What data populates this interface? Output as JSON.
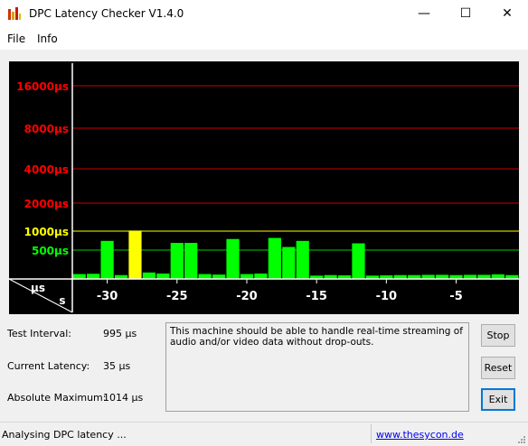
{
  "window": {
    "title": "DPC Latency Checker V1.4.0",
    "minimize_glyph": "—",
    "maximize_glyph": "☐",
    "close_glyph": "✕"
  },
  "menu": {
    "items": [
      "File",
      "Info"
    ]
  },
  "chart_data": {
    "type": "bar",
    "xlabel": "s",
    "ylabel": "µs",
    "x_ticks": [
      -30,
      -25,
      -20,
      -15,
      -10,
      -5
    ],
    "x_tick_labels": [
      "-30",
      "-25",
      "-20",
      "-15",
      "-10",
      "-5"
    ],
    "y_tick_labels": [
      "16000µs",
      "8000µs",
      "4000µs",
      "2000µs",
      "1000µs",
      "500µs"
    ],
    "y_tick_colors": [
      "#ff0000",
      "#ff0000",
      "#ff0000",
      "#ff0000",
      "#ffff00",
      "#00ff00"
    ],
    "x_range": [
      -32.5,
      -0.5
    ],
    "bar_times": [
      -32,
      -31,
      -30,
      -29,
      -28,
      -27,
      -26,
      -25,
      -24,
      -23,
      -22,
      -21,
      -20,
      -19,
      -18,
      -17,
      -16,
      -15,
      -14,
      -13,
      -12,
      -11,
      -10,
      -9,
      -8,
      -7,
      -6,
      -5,
      -4,
      -3,
      -2,
      -1
    ],
    "values_us": [
      60,
      65,
      700,
      40,
      1014,
      90,
      70,
      650,
      650,
      60,
      50,
      750,
      60,
      70,
      780,
      560,
      700,
      30,
      40,
      35,
      640,
      30,
      35,
      40,
      40,
      45,
      45,
      40,
      45,
      45,
      55,
      40
    ],
    "colors": {
      "background": "#000000",
      "normal_bar": "#00ff00",
      "warning_bar": "#ffff00",
      "grid_red": "#cc0000",
      "grid_yellow": "#ffff00",
      "grid_green": "#00cc00",
      "axis": "#ffffff"
    }
  },
  "info": {
    "test_interval_label": "Test Interval:",
    "test_interval_value": "995 µs",
    "current_latency_label": "Current Latency:",
    "current_latency_value": "35 µs",
    "absolute_maximum_label": "Absolute Maximum:",
    "absolute_maximum_value": "1014 µs"
  },
  "message": "This machine should be able to handle real-time streaming of audio and/or video data without drop-outs.",
  "buttons": {
    "stop": "Stop",
    "reset": "Reset",
    "exit": "Exit"
  },
  "status": {
    "text": "Analysing DPC latency ...",
    "link": "www.thesycon.de"
  }
}
